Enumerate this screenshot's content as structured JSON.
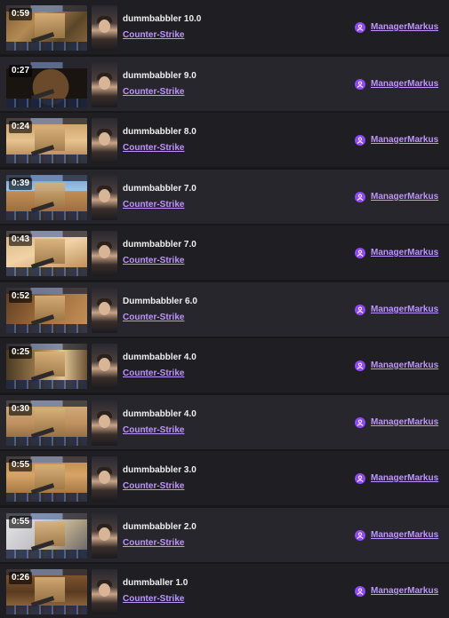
{
  "clips": [
    {
      "duration": "0:59",
      "title": "dummbabbler 10.0",
      "game": "Counter-Strike",
      "channel": "ManagerMarkus"
    },
    {
      "duration": "0:27",
      "title": "dummbabbler 9.0",
      "game": "Counter-Strike",
      "channel": "ManagerMarkus"
    },
    {
      "duration": "0:24",
      "title": "dummbabbler 8.0",
      "game": "Counter-Strike",
      "channel": "ManagerMarkus"
    },
    {
      "duration": "0:39",
      "title": "dummbabbler 7.0",
      "game": "Counter-Strike",
      "channel": "ManagerMarkus"
    },
    {
      "duration": "0:43",
      "title": "dummbabbler 7.0",
      "game": "Counter-Strike",
      "channel": "ManagerMarkus"
    },
    {
      "duration": "0:52",
      "title": "Dummbabbler 6.0",
      "game": "Counter-Strike",
      "channel": "ManagerMarkus"
    },
    {
      "duration": "0:25",
      "title": "dummbabbler 4.0",
      "game": "Counter-Strike",
      "channel": "ManagerMarkus"
    },
    {
      "duration": "0:30",
      "title": "dummbabbler 4.0",
      "game": "Counter-Strike",
      "channel": "ManagerMarkus"
    },
    {
      "duration": "0:55",
      "title": "dummbabbler 3.0",
      "game": "Counter-Strike",
      "channel": "ManagerMarkus"
    },
    {
      "duration": "0:55",
      "title": "dummbabbler 2.0",
      "game": "Counter-Strike",
      "channel": "ManagerMarkus"
    },
    {
      "duration": "0:26",
      "title": "dummballer 1.0",
      "game": "Counter-Strike",
      "channel": "ManagerMarkus"
    }
  ],
  "colors": {
    "background": "#18181b",
    "row": "#1f1f23",
    "row_alt": "#26262c",
    "link": "#bf94ff",
    "badge": "#9147ff",
    "title": "#efeff1"
  },
  "icons": {
    "channel_badge": "user-badge-icon"
  }
}
